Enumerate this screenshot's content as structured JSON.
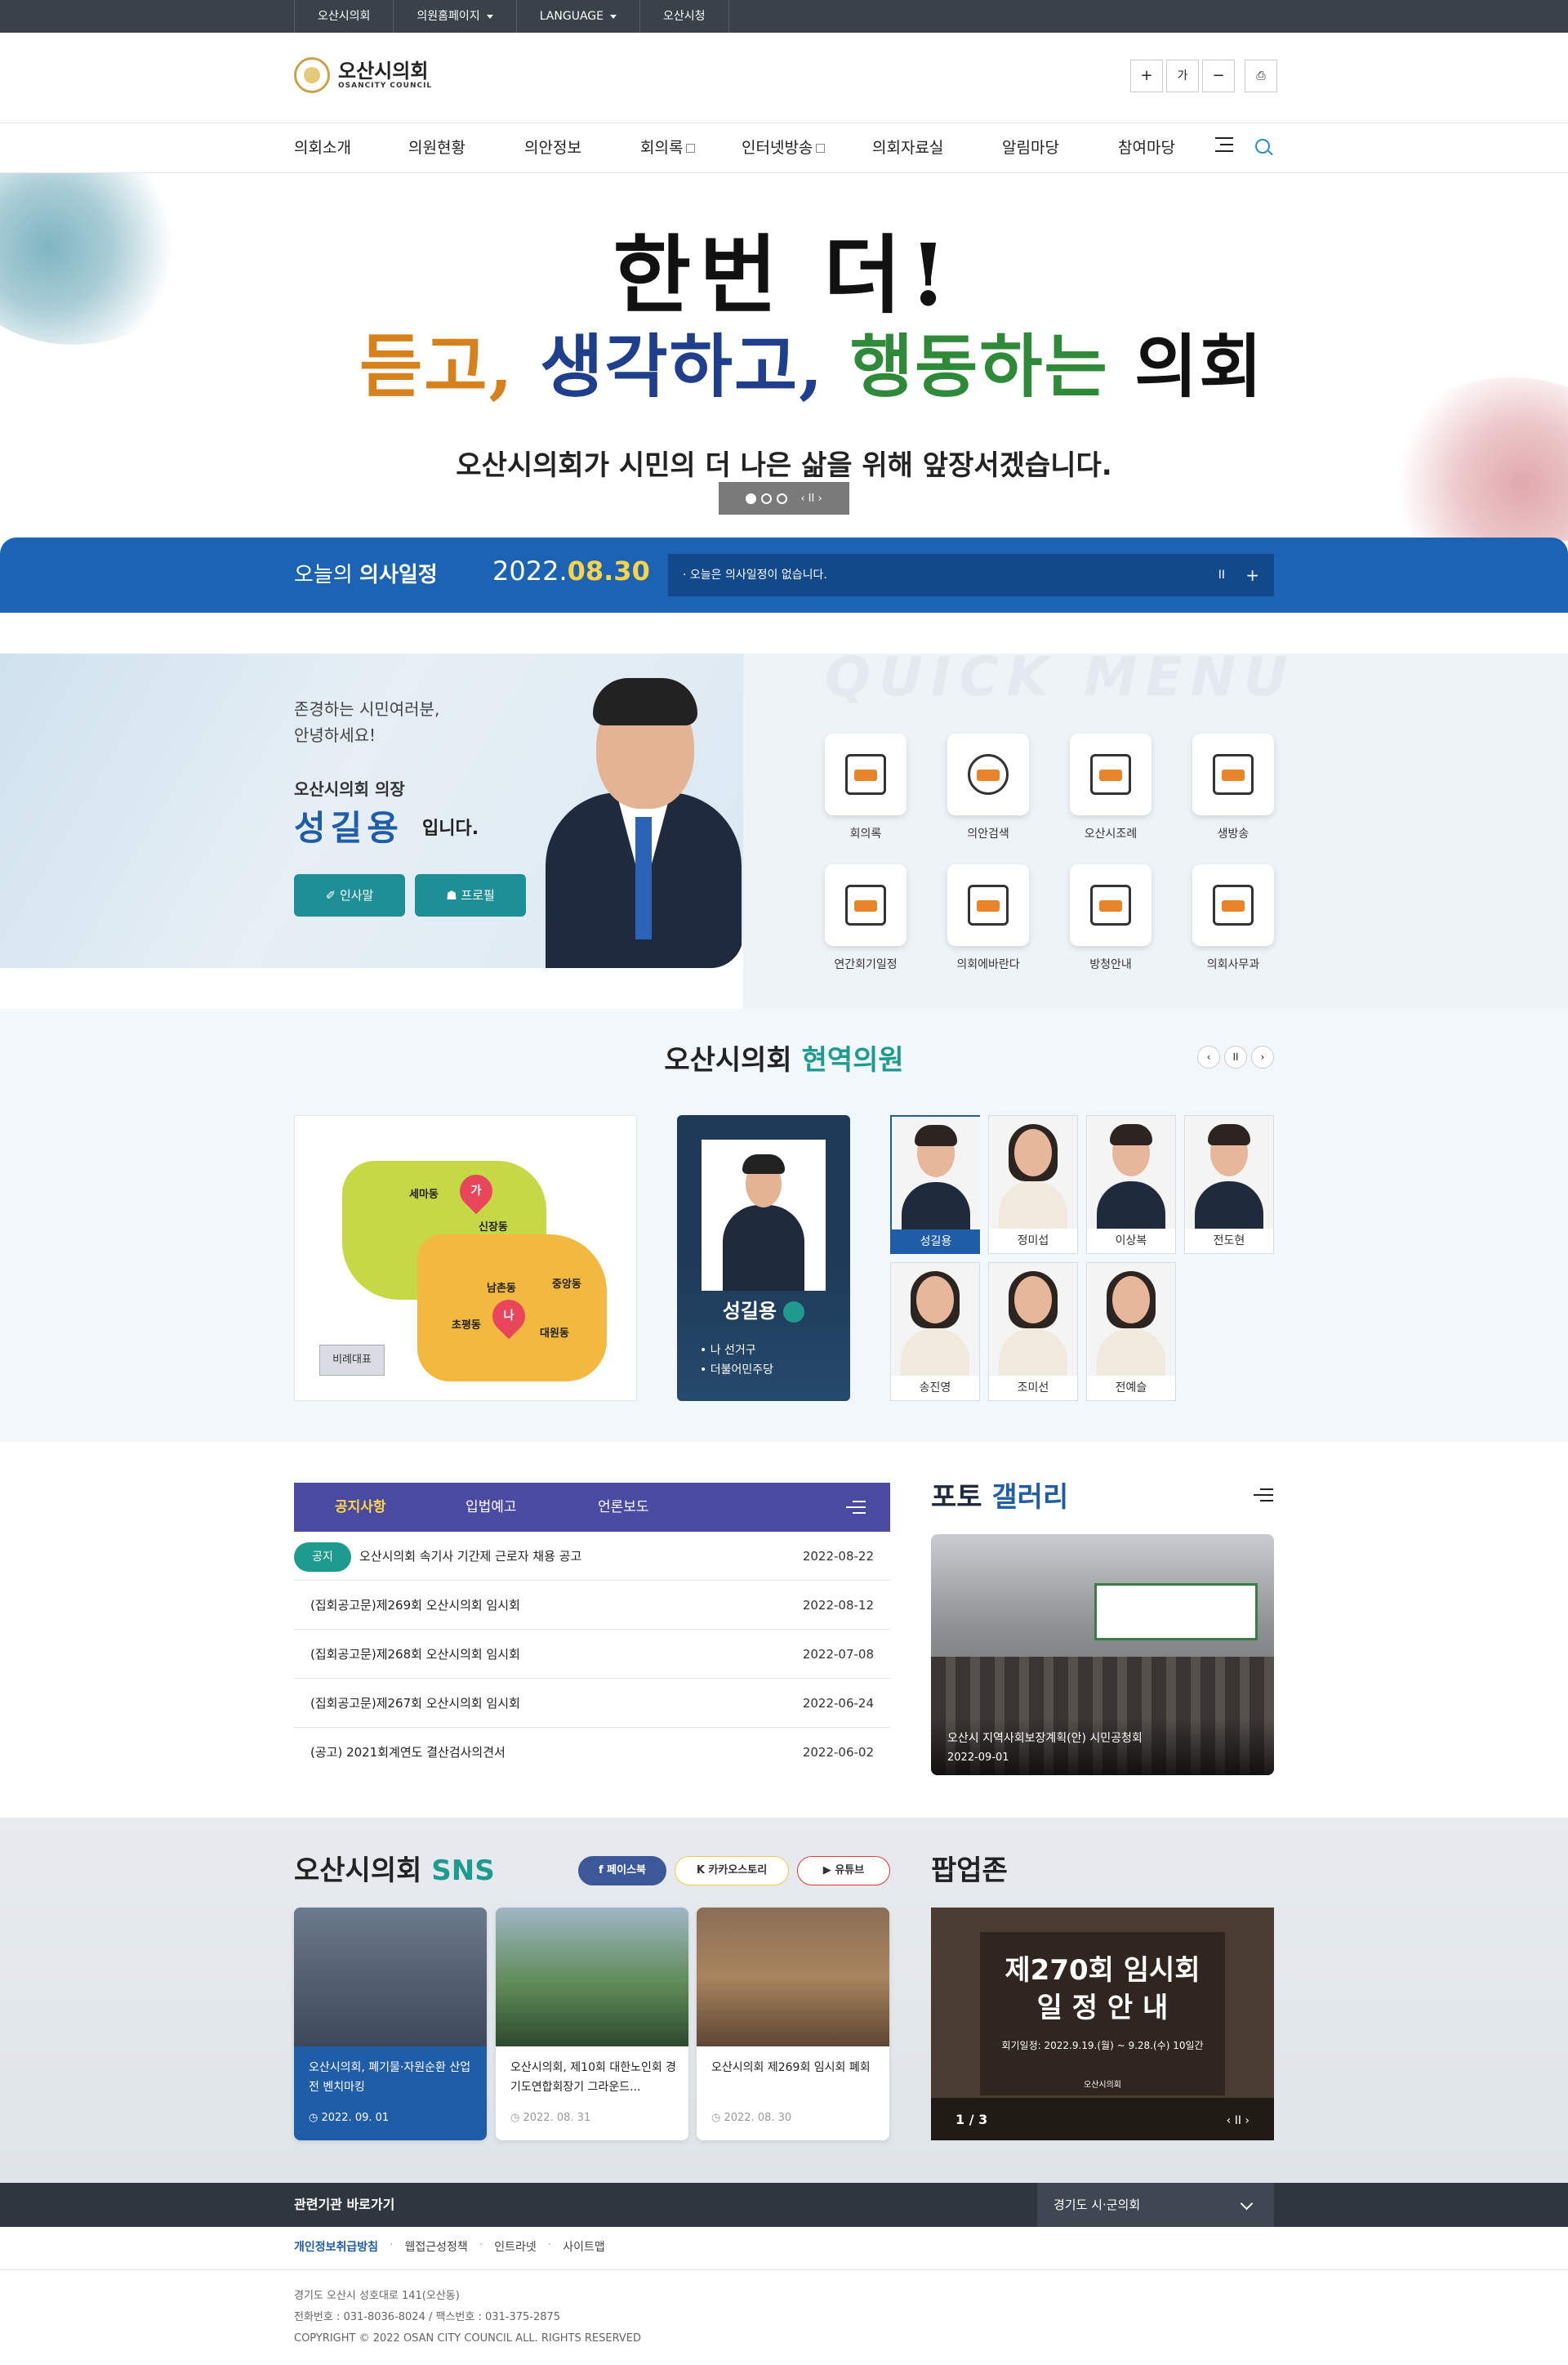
{
  "util_bar": {
    "items": [
      "오산시의회",
      "의원홈페이지",
      "LANGUAGE",
      "오산시청"
    ]
  },
  "header": {
    "logo_title": "오산시의회",
    "logo_sub": "OSANCITY COUNCIL",
    "buttons": {
      "zoom_in": "+",
      "font": "가",
      "zoom_out": "−",
      "print": "⎙"
    }
  },
  "nav": {
    "items": [
      "의회소개",
      "의원현황",
      "의안정보",
      "회의록",
      "인터넷방송",
      "의회자료실",
      "알림마당",
      "참여마당"
    ]
  },
  "visual": {
    "slogan_line1": "한번 더!",
    "slogan_a": "듣고,",
    "slogan_b": "생각하고,",
    "slogan_c": "행동하는",
    "slogan_d": "의회",
    "subtitle": "오산시의회가 시민의 더 나은 삶을 위해 앞장서겠습니다.",
    "control": "‹ II ›"
  },
  "schedule": {
    "label_pre": "오늘의",
    "label_bold": "의사일정",
    "date_pre": "2022.",
    "date_bold": "08.30",
    "message": "· 오늘은 의사일정이 없습니다.",
    "pause": "II",
    "plus": "+"
  },
  "greeting": {
    "line1": "존경하는 시민여러분,",
    "line2": "안녕하세요!",
    "role": "오산시의회 의장",
    "name": "성길용",
    "suffix": "입니다.",
    "btn_greeting": "✐ 인사말",
    "btn_profile": "☗ 프로필"
  },
  "quick_menu": {
    "watermark": "QUICK MENU",
    "items": [
      "회의록",
      "의안검색",
      "오산시조례",
      "생방송",
      "연간회기일정",
      "의회에바란다",
      "방청안내",
      "의회사무과"
    ]
  },
  "members": {
    "title_a": "오산시의회",
    "title_b": "현역의원",
    "controls": [
      "‹",
      "II",
      "›"
    ],
    "map_labels": [
      "세마동",
      "신장동",
      "남촌동",
      "중앙동",
      "초평동",
      "대원동"
    ],
    "pins": [
      "가",
      "나"
    ],
    "proportional": "비례대표",
    "featured_name": "성길용",
    "featured_district": "• 나 선거구",
    "featured_party": "• 더불어민주당",
    "cards": [
      "성길용",
      "정미섭",
      "이상복",
      "전도현",
      "송진영",
      "조미선",
      "전예슬"
    ]
  },
  "notices": {
    "tabs": [
      "공지사항",
      "입법예고",
      "언론보도"
    ],
    "badge": "공지",
    "rows": [
      {
        "title": "오산시의회 속기사 기간제 근로자 채용 공고",
        "date": "2022-08-22"
      },
      {
        "title": "(집회공고문)제269회 오산시의회 임시회",
        "date": "2022-08-12"
      },
      {
        "title": "(집회공고문)제268회 오산시의회 임시회",
        "date": "2022-07-08"
      },
      {
        "title": "(집회공고문)제267회 오산시의회 임시회",
        "date": "2022-06-24"
      },
      {
        "title": "(공고) 2021회계연도 결산검사의견서",
        "date": "2022-06-02"
      }
    ]
  },
  "gallery": {
    "title_a": "포토",
    "title_b": "갤러리",
    "caption": "오산시 지역사회보장계획(안) 시민공청회",
    "date": "2022-09-01"
  },
  "sns": {
    "title_a": "오산시의회",
    "title_b": "SNS",
    "buttons": [
      "f 페이스북",
      "K 카카오스토리",
      "▶ 유튜브"
    ],
    "cards": [
      {
        "text": "오산시의회, 폐기물·자원순환 산업전 벤치마킹",
        "date": "◷ 2022. 09. 01"
      },
      {
        "text": "오산시의회, 제10회 대한노인회 경기도연합회장기 그라운드...",
        "date": "◷ 2022. 08. 31"
      },
      {
        "text": "오산시의회 제269회 임시회 폐회",
        "date": "◷ 2022. 08. 30"
      }
    ]
  },
  "popup": {
    "title": "팝업존",
    "heading1": "제270회 임시회",
    "heading2": "일 정 안 내",
    "period": "회기일정: 2022.9.19.(월) ~ 9.28.(수) 10일간",
    "org": "오산시의회",
    "page": "1 / 3",
    "control": "‹ II ›"
  },
  "footer": {
    "related": "관련기관 바로가기",
    "select": "경기도 시·군의회",
    "links": [
      "개인정보취급방침",
      "웹접근성정책",
      "인트라넷",
      "사이트맵"
    ],
    "address": "경기도 오산시 성호대로 141(오산동)",
    "phone": "전화번호 : 031-8036-8024 / 팩스번호 : 031-375-2875",
    "copyright": "COPYRIGHT © 2022 OSAN CITY COUNCIL ALL. RIGHTS RESERVED"
  },
  "colors": {
    "primary_blue": "#1c63b3",
    "teal": "#1f9a8f",
    "purple_tab": "#4b4aa1",
    "highlight_yellow": "#fcd34a",
    "dark_bar": "#39414a"
  }
}
